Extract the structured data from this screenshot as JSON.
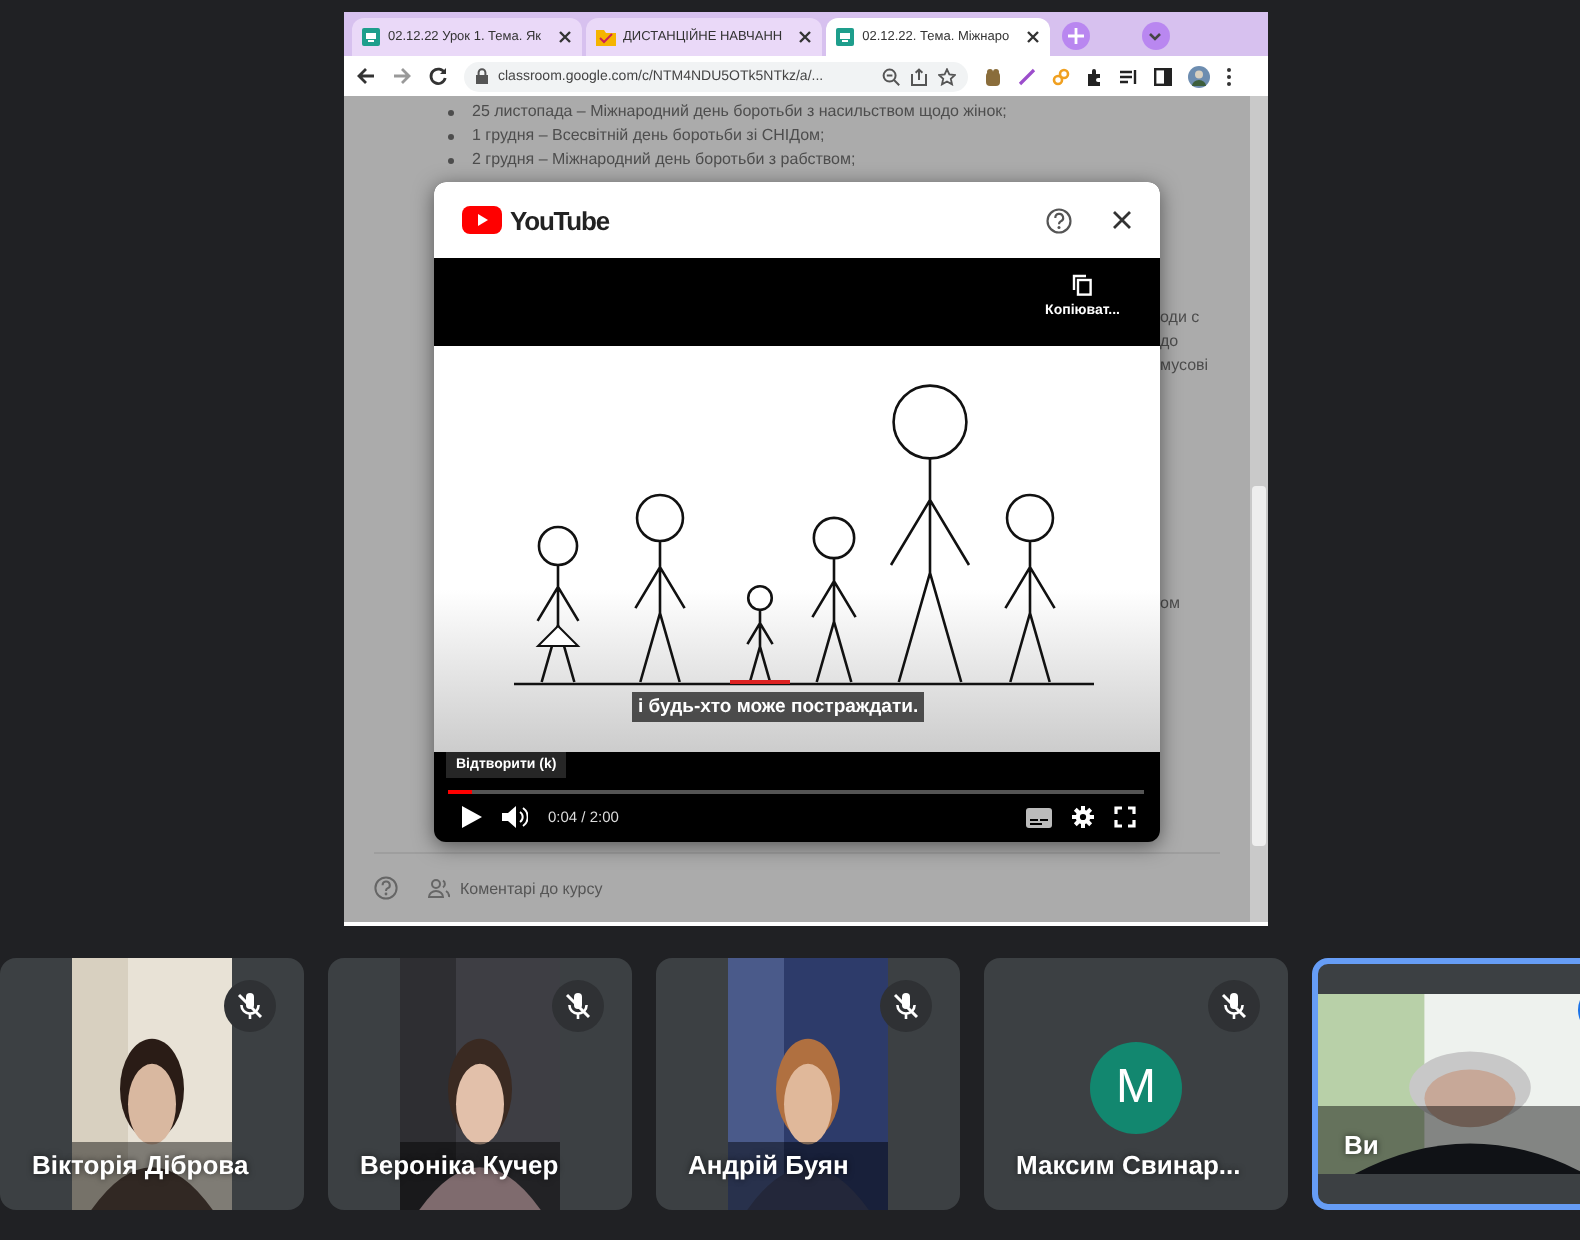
{
  "browser": {
    "tabs": [
      {
        "title": "02.12.22 Урок 1. Тема. Як",
        "kind": "classroom",
        "selected": false
      },
      {
        "title": "ДИСТАНЦІЙНЕ НАВЧАНН",
        "kind": "folder",
        "selected": false
      },
      {
        "title": "02.12.22. Тема. Міжнаро",
        "kind": "classroom",
        "selected": true
      }
    ],
    "url": "classroom.google.com/c/NTM4NDU5OTk5NTkz/a/..."
  },
  "page": {
    "bullets": [
      "25 листопада – Міжнародний день боротьби з насильством щодо жінок;",
      "1 грудня – Всесвітній день боротьби зі СНІДом;",
      "2 грудня – Міжнародний день боротьби з рабством;"
    ],
    "fragments": [
      "оди с",
      "до",
      "мусові",
      "ом"
    ],
    "comments_label": "Коментарі до курсу"
  },
  "video_dialog": {
    "brand": "YouTube",
    "copy_label": "Копіюват...",
    "subtitle": "і будь-хто може постраждати.",
    "tooltip": "Відтворити (k)",
    "progress": {
      "level": 0.035
    },
    "time": "0:04 / 2:00"
  },
  "participants": [
    {
      "name": "Вікторія Діброва",
      "kind": "video",
      "muted": true,
      "highlighted": false
    },
    {
      "name": "Вероніка Кучер",
      "kind": "video",
      "muted": true,
      "highlighted": false
    },
    {
      "name": "Андрій Буян",
      "kind": "video",
      "muted": true,
      "highlighted": false
    },
    {
      "name": "Максим Свинар...",
      "kind": "avatar",
      "initial": "М",
      "muted": true,
      "highlighted": false
    },
    {
      "name": "Ви",
      "kind": "video",
      "muted": false,
      "highlighted": true
    }
  ]
}
